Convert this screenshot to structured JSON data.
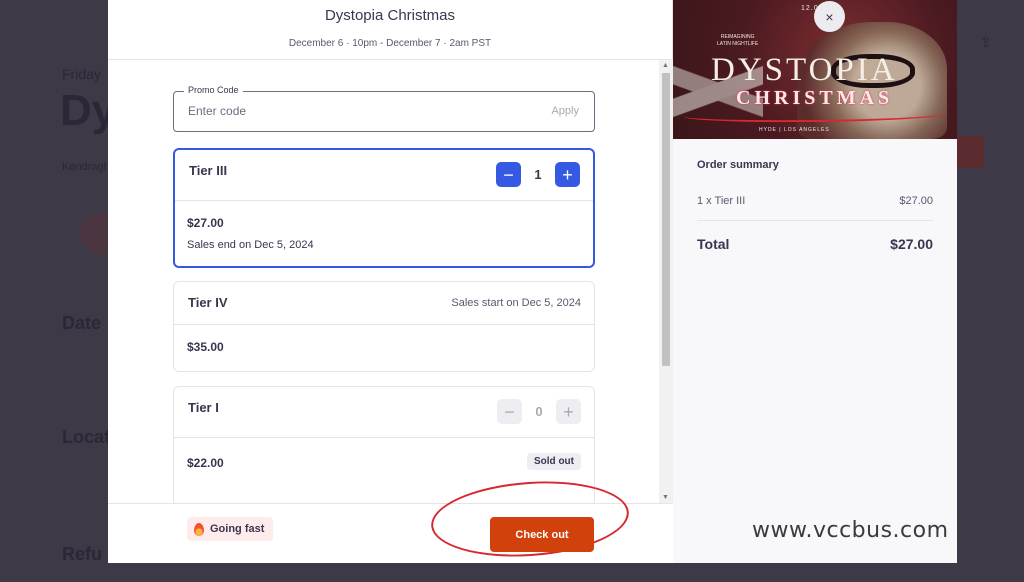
{
  "background": {
    "date_fragment": "Friday",
    "title_fragment": "Dy",
    "organizer_fragment": "Kendragh",
    "date_section_fragment": "Date",
    "location_section_fragment": "Locat",
    "refund_section_fragment": "Refu"
  },
  "event": {
    "title": "Dystopia Christmas",
    "dates": "December 6 · 10pm - December 7 · 2am PST"
  },
  "promo": {
    "label": "Promo Code",
    "placeholder": "Enter code",
    "apply_label": "Apply"
  },
  "tiers": [
    {
      "name": "Tier III",
      "quantity": "1",
      "price": "$27.00",
      "note": "Sales end on Dec 5, 2024"
    },
    {
      "name": "Tier IV",
      "status": "Sales start on Dec 5, 2024",
      "price": "$35.00"
    },
    {
      "name": "Tier I",
      "quantity": "0",
      "price": "$22.00",
      "badge": "Sold out"
    }
  ],
  "stepper": {
    "minus": "−",
    "plus": "+"
  },
  "footer": {
    "going_fast": "Going fast",
    "checkout_label": "Check out"
  },
  "hero": {
    "date": "12.06.24",
    "tagline_1": "REIMAGINING",
    "tagline_2": "LATIN NIGHTLIFE",
    "title_line1": "DYSTOPIA",
    "title_line2": "CHRISTMAS",
    "venue": "HYDE | LOS ANGELES"
  },
  "summary": {
    "title": "Order summary",
    "line_item": "1 x Tier III",
    "line_amount": "$27.00",
    "total_label": "Total",
    "total_amount": "$27.00"
  },
  "close_icon": "×",
  "watermark": "www.vccbus.com",
  "colors": {
    "accent_blue": "#3659e3",
    "checkout_orange": "#d1410c",
    "annotation_red": "#d8282e"
  }
}
